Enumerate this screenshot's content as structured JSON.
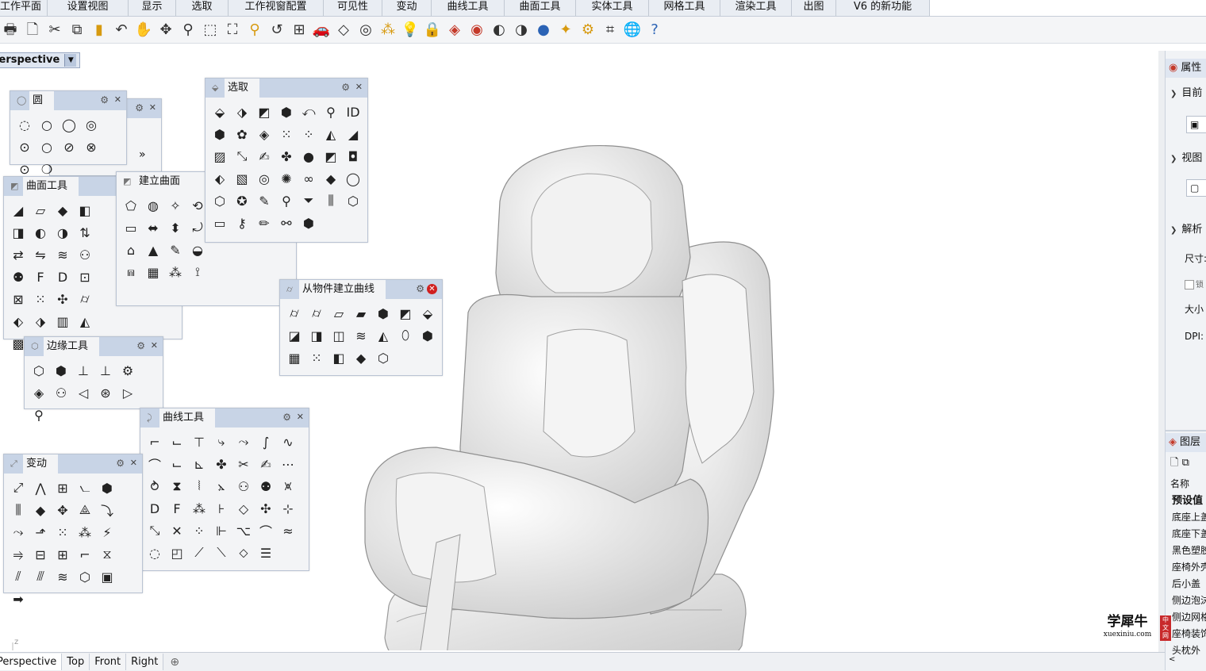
{
  "menu_tabs": [
    "工作平面",
    "设置视图",
    "显示",
    "选取",
    "工作视窗配置",
    "可见性",
    "变动",
    "曲线工具",
    "曲面工具",
    "实体工具",
    "网格工具",
    "渲染工具",
    "出图",
    "V6 的新功能"
  ],
  "viewport": {
    "name": "Perspective"
  },
  "panels": {
    "circle": {
      "title": "圆"
    },
    "surface_tools": {
      "title": "曲面工具"
    },
    "create_surface": {
      "title": "建立曲面"
    },
    "select": {
      "title": "选取"
    },
    "curve_from_object": {
      "title": "从物件建立曲线"
    },
    "edge_tools": {
      "title": "边缘工具"
    },
    "curve_tools": {
      "title": "曲线工具"
    },
    "transform": {
      "title": "变动"
    }
  },
  "bottom_tabs": [
    "Perspective",
    "Top",
    "Front",
    "Right"
  ],
  "right_panel": {
    "properties_tab": "属性",
    "section_current": "目前",
    "section_view": "视图",
    "section_resolution": "解析",
    "size_label": "尺寸:",
    "lock_label": "锁",
    "size_big": "大小",
    "dpi_label": "DPI:",
    "layers_tab": "图层",
    "name_header": "名称",
    "layers": [
      "预设值",
      "底座上盖",
      "底座下盖",
      "黑色塑胶",
      "座椅外壳",
      "后小盖",
      "侧边泡沫",
      "侧边网格",
      "座椅装饰",
      "头枕外"
    ]
  },
  "watermark": {
    "text": "学犀牛",
    "url": "xuexiniu.com",
    "badge": "中文网"
  },
  "axes": {
    "z": "z",
    "x": "x"
  },
  "colors": {
    "panel_header": "#c8d4e6",
    "accent_blue": "#2a5fc4"
  }
}
